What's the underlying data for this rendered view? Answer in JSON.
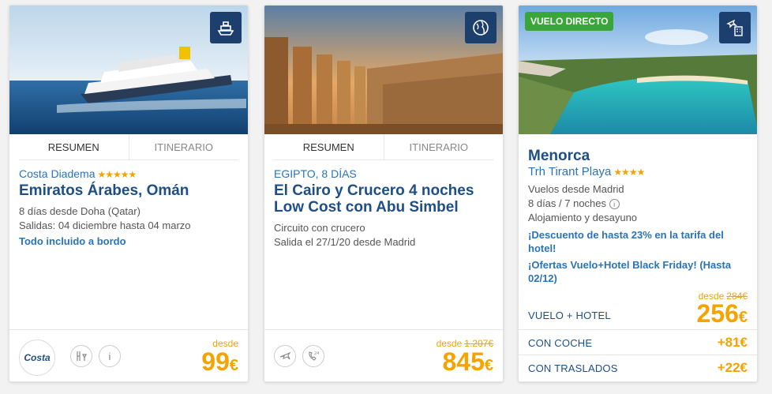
{
  "cards": [
    {
      "tabs": [
        "RESUMEN",
        "ITINERARIO"
      ],
      "ship": "Costa Diadema",
      "stars": "★★★★★",
      "title": "Emiratos Árabes, Omán",
      "lines": [
        "8 días desde Doha (Qatar)",
        "Salidas: 04 diciembre hasta 04 marzo"
      ],
      "highlight": "Todo incluido a bordo",
      "logo_text": "Costa",
      "desde": "desde",
      "price": "99",
      "currency": "€",
      "badge_icon": "cruise-ship-icon"
    },
    {
      "tabs": [
        "RESUMEN",
        "ITINERARIO"
      ],
      "subtitle": "EGIPTO, 8 DÍAS",
      "title": "El Cairo y Crucero 4 noches Low Cost con Abu Simbel",
      "lines": [
        "Circuito con crucero",
        "Salida el 27/1/20 desde Madrid"
      ],
      "desde": "desde",
      "old_price": "1.207€",
      "price": "845",
      "currency": "€",
      "badge_icon": "globe-icon"
    },
    {
      "badge": "VUELO DIRECTO",
      "title": "Menorca",
      "hotel": "Trh Tirant Playa",
      "stars": "★★★★",
      "lines": [
        "Vuelos desde Madrid",
        "8 días / 7 noches",
        "Alojamiento y desayuno"
      ],
      "promo1": "¡Descuento de hasta 23% en la tarifa del hotel!",
      "promo2": "¡Ofertas Vuelo+Hotel Black Friday! (Hasta 02/12)",
      "desde": "desde",
      "old_price": "284€",
      "main_label": "VUELO + HOTEL",
      "price": "256",
      "currency": "€",
      "extras": [
        {
          "label": "CON COCHE",
          "price": "+81€"
        },
        {
          "label": "CON TRASLADOS",
          "price": "+22€"
        }
      ],
      "badge_icon": "flight-hotel-icon"
    }
  ]
}
